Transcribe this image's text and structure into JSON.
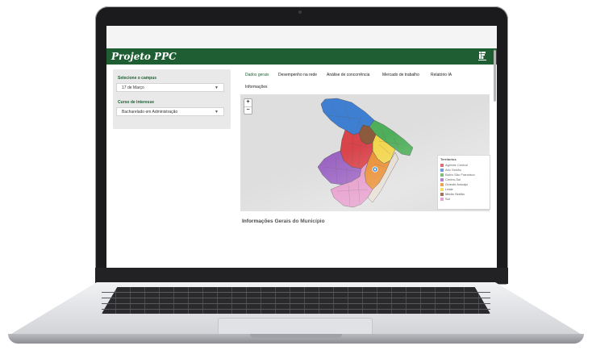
{
  "app": {
    "title": "Projeto PPC"
  },
  "sidebar": {
    "campus_label": "Selecione o campus",
    "campus_value": "17 de Março",
    "course_label": "Curso de interesse",
    "course_value": "Bacharelado em Administração"
  },
  "tabs": [
    {
      "label": "Dados gerais",
      "active": true
    },
    {
      "label": "Desempenho na rede"
    },
    {
      "label": "Análise de concorrência"
    },
    {
      "label": "Mercado de trabalho"
    },
    {
      "label": "Relatório IA"
    },
    {
      "label": "Informações"
    }
  ],
  "map": {
    "zoom_in": "+",
    "zoom_out": "−",
    "legend_title": "Territorios",
    "legend": [
      {
        "label": "Agreste Central",
        "color": "#d9434a"
      },
      {
        "label": "Alto Sertão",
        "color": "#3f7fd1"
      },
      {
        "label": "Baixo São Francisco",
        "color": "#4fae5a"
      },
      {
        "label": "Centro-Sul",
        "color": "#9a62c2"
      },
      {
        "label": "Grande Aracaju",
        "color": "#e98b2d"
      },
      {
        "label": "Leste",
        "color": "#f2d54a"
      },
      {
        "label": "Médio Sertão",
        "color": "#8c5a3c"
      },
      {
        "label": "Sul",
        "color": "#e596c8"
      }
    ]
  },
  "section": {
    "title": "Informações Gerais do Município"
  }
}
